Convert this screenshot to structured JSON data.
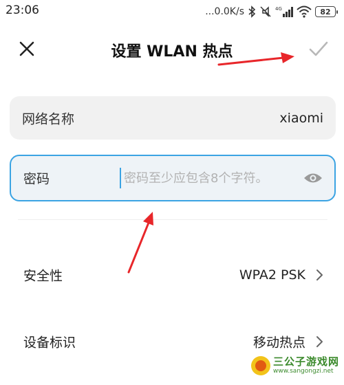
{
  "status_bar": {
    "time": "23:06",
    "speed": "...0.0K/s",
    "battery": "82"
  },
  "header": {
    "title": "设置 WLAN 热点",
    "close_icon": "close-icon",
    "confirm_icon": "checkmark-icon"
  },
  "fields": {
    "ssid": {
      "label": "网络名称",
      "value": "xiaomi"
    },
    "password": {
      "label": "密码",
      "value": "",
      "placeholder": "密码至少应包含8个字符。",
      "toggle_icon": "eye-icon"
    }
  },
  "settings": [
    {
      "label": "安全性",
      "value": "WPA2 PSK"
    },
    {
      "label": "设备标识",
      "value": "移动热点"
    }
  ],
  "annotations": {
    "arrow_color": "#e8262a",
    "count": 2
  },
  "colors": {
    "focus_border": "#3aa3e3",
    "field_bg": "#f1f1f1"
  },
  "watermark": {
    "name": "三公子游戏网",
    "url": "www.sangongzi.net"
  }
}
